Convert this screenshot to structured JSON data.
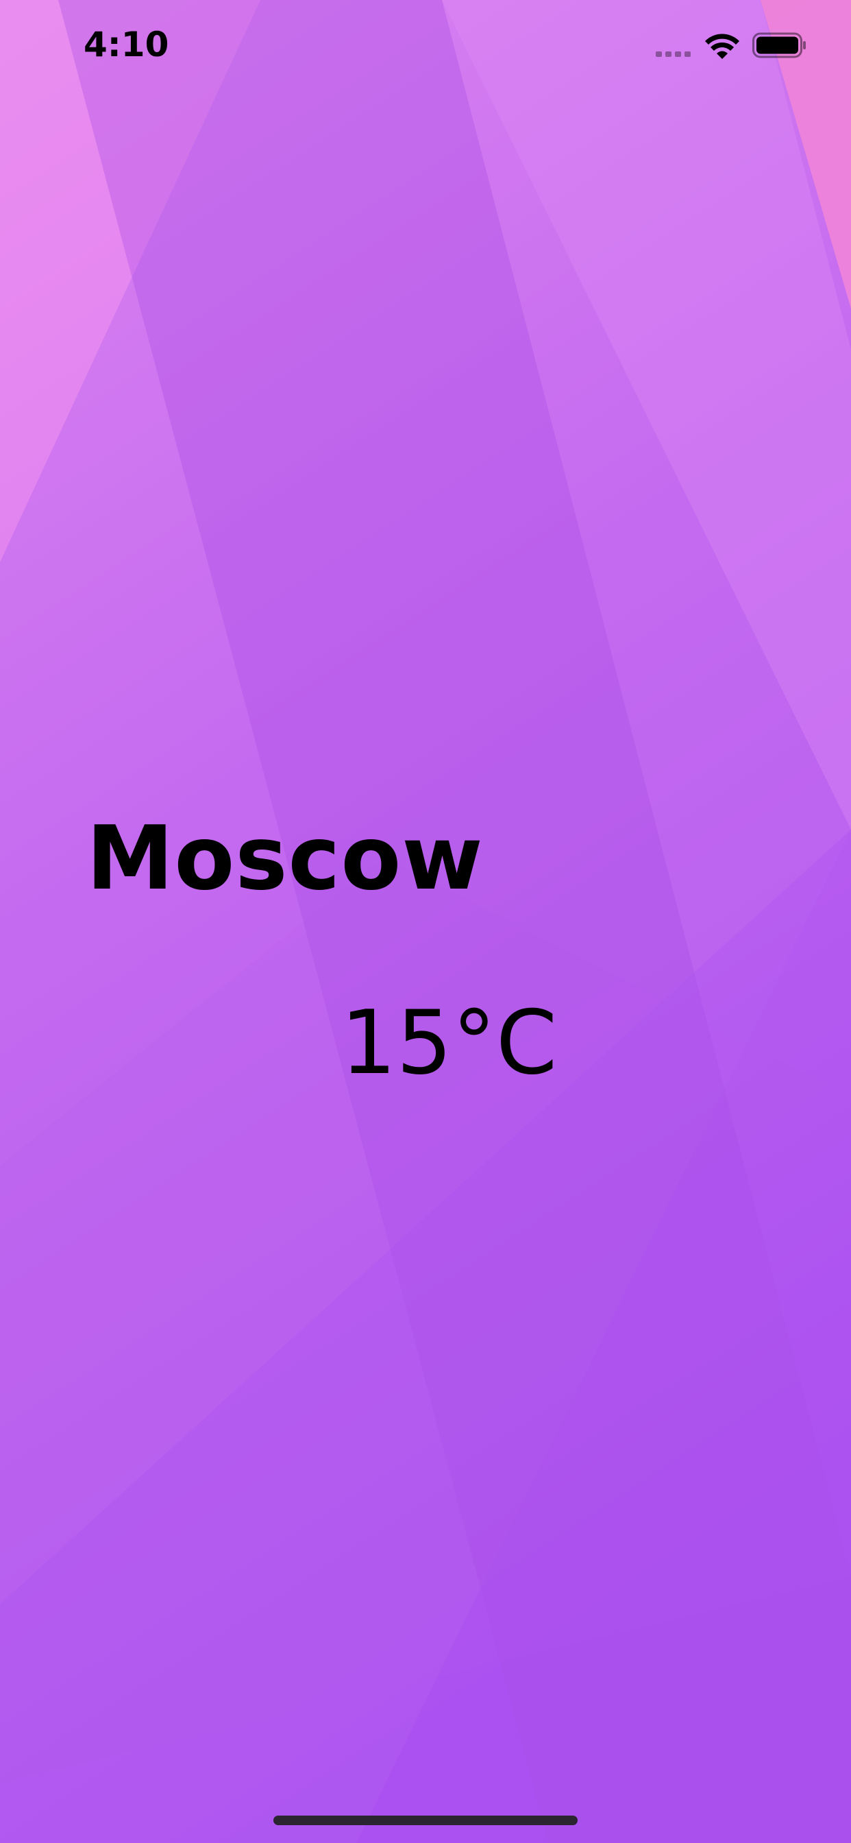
{
  "status_bar": {
    "time": "4:10",
    "wifi_icon": "wifi-icon",
    "battery_icon": "battery-full-icon",
    "signal_icon": "cellular-signal-icon"
  },
  "weather": {
    "city": "Moscow",
    "temperature": "15°C"
  },
  "colors": {
    "background_top": "#e48aee",
    "background_mid": "#b95ff0",
    "background_bottom": "#a54be8",
    "text": "#000000"
  }
}
